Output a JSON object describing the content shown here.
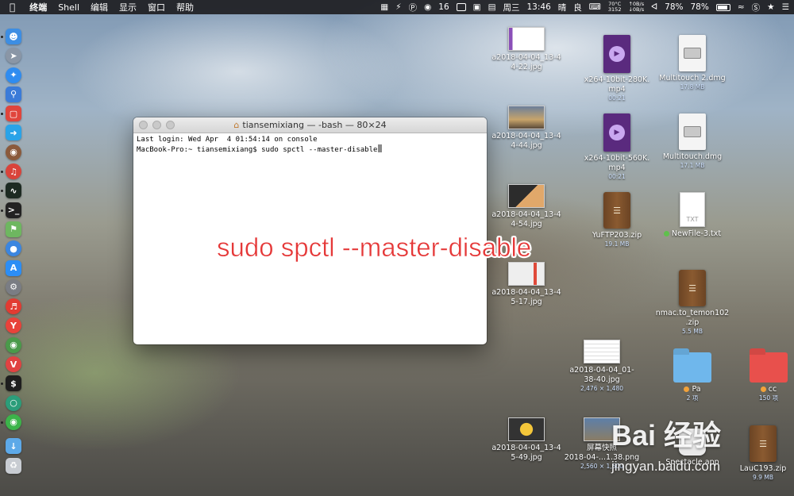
{
  "menubar": {
    "app_name": "终端",
    "menus": [
      "Shell",
      "编辑",
      "显示",
      "窗口",
      "帮助"
    ],
    "wechat_count": "16",
    "temp": "70°C",
    "rpm": "3152",
    "net_up": "0B/s",
    "net_down": "0B/s",
    "weekday": "周三",
    "time": "13:46",
    "weather1": "晴",
    "weather2": "良",
    "battery1": "78%",
    "battery2": "78%"
  },
  "terminal": {
    "title": "tiansemixiang — -bash — 80×24",
    "line1": "Last login: Wed Apr  4 01:54:14 on console",
    "prompt": "MacBook-Pro:~ tiansemixiang$ ",
    "command": "sudo spctl --master-disable"
  },
  "overlay_text": "sudo spctl --master-disable",
  "desktop": {
    "files": [
      {
        "name": "a2018-04-04_13-4\n4-22.jpg"
      },
      {
        "name": "x264-10bit-280K.\nmp4",
        "meta": "00:21"
      },
      {
        "name": "Multitouch 2.dmg",
        "meta": "17.8 MB"
      },
      {
        "name": "a2018-04-04_13-4\n4-44.jpg"
      },
      {
        "name": "x264-10bit-560K.\nmp4",
        "meta": "00:21"
      },
      {
        "name": "Multitouch.dmg",
        "meta": "17.1 MB"
      },
      {
        "name": "a2018-04-04_13-4\n4-54.jpg"
      },
      {
        "name": "YuFTP203.zip",
        "meta": "19.1 MB"
      },
      {
        "name": "NewFile-3.txt"
      },
      {
        "name": "a2018-04-04_13-4\n5-17.jpg"
      },
      {
        "name": "nmac.to_temon102\n.zip",
        "meta": "5.5 MB"
      },
      {
        "name": "a2018-04-04_01-\n38-40.jpg",
        "meta": "2,476 × 1,480"
      },
      {
        "name": "Pa",
        "meta": "2 项"
      },
      {
        "name": "cc",
        "meta": "150 项"
      },
      {
        "name": "a2018-04-04_13-4\n5-49.jpg"
      },
      {
        "name": "屏幕快照\n2018-04-...1.38.png",
        "meta": "2,560 × 1,600"
      },
      {
        "name": "Spectacle.app"
      },
      {
        "name": "LauC193.zip",
        "meta": "9.9 MB"
      }
    ],
    "txt_label": "TXT"
  },
  "watermark": {
    "main": "Bai  经验",
    "sub": "jingyan.baidu.com"
  },
  "colors": {
    "overlay_red": "#e53838",
    "folder_blue": "#6fb7ec",
    "folder_red": "#e8504c",
    "tag_orange": "#f2a23a",
    "tag_green": "#5fc04c"
  }
}
